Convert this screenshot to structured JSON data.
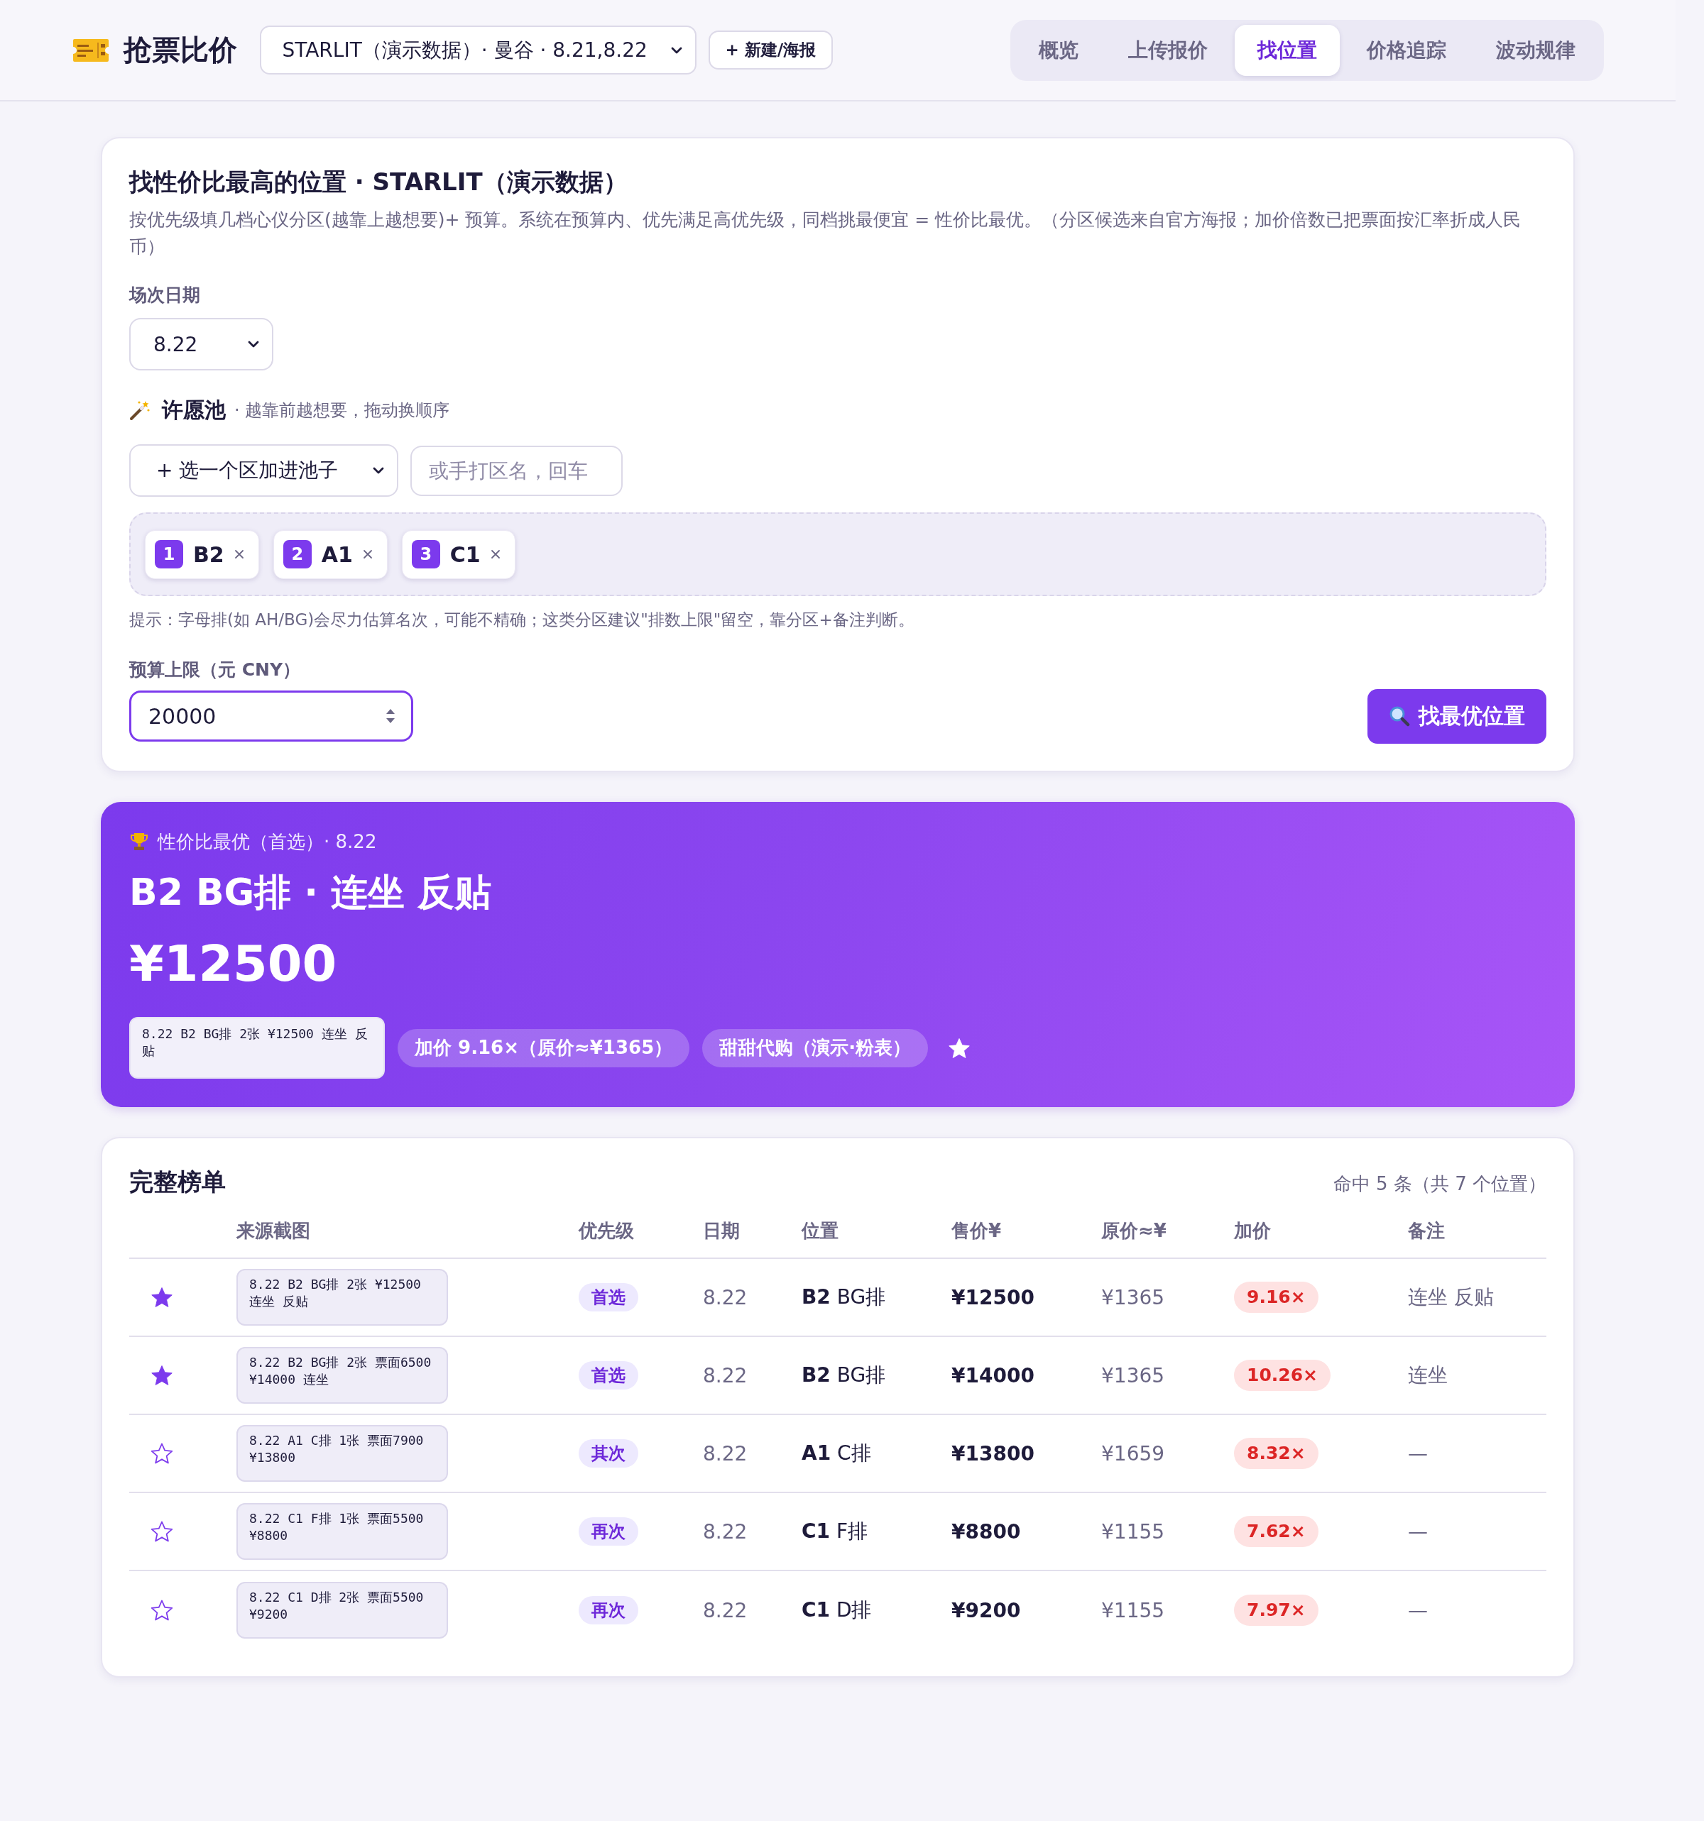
{
  "header": {
    "app_title": "抢票比价",
    "event_select": "STARLIT（演示数据）· 曼谷 · 8.21,8.22",
    "new_button": "+ 新建/海报"
  },
  "tabs": [
    {
      "label": "概览",
      "selected": false
    },
    {
      "label": "上传报价",
      "selected": false
    },
    {
      "label": "找位置",
      "selected": true
    },
    {
      "label": "价格追踪",
      "selected": false
    },
    {
      "label": "波动规律",
      "selected": false
    }
  ],
  "finder": {
    "title": "找性价比最高的位置 · STARLIT（演示数据）",
    "description": "按优先级填几档心仪分区(越靠上越想要)+ 预算。系统在预算内、优先满足高优先级，同档挑最便宜 = 性价比最优。（分区候选来自官方海报；加价倍数已把票面按汇率折成人民币）",
    "date_label": "场次日期",
    "date_select": "8.22",
    "wish_pool": {
      "title": "许愿池",
      "subtitle": "· 越靠前越想要，拖动换顺序",
      "zone_select": "+ 选一个区加进池子",
      "zone_input": {
        "placeholder": "或手打区名，回车"
      },
      "chips": [
        {
          "rank": "1",
          "zone": "B2"
        },
        {
          "rank": "2",
          "zone": "A1"
        },
        {
          "rank": "3",
          "zone": "C1"
        }
      ]
    },
    "hint": "提示：字母排(如 AH/BG)会尽力估算名次，可能不精确；这类分区建议\"排数上限\"留空，靠分区+备注判断。",
    "budget_label": "预算上限（元 CNY）",
    "budget_input": {
      "value": "20000"
    },
    "search_button": "找最优位置"
  },
  "best": {
    "caption": "性价比最优（首选）· 8.22",
    "title": "B2 BG排 · 连坐 反贴",
    "price": "¥12500",
    "snippet": "8.22 B2 BG排 2张 ¥12500 连坐 反贴",
    "markup_pill": "加价 9.16×（原价≈¥1365）",
    "seller_pill": "甜甜代购（演示·粉表）",
    "starred": true
  },
  "ranking": {
    "title": "完整榜单",
    "count": "命中 5 条（共 7 个位置）",
    "columns": [
      "来源截图",
      "优先级",
      "日期",
      "位置",
      "售价¥",
      "原价≈¥",
      "加价",
      "备注"
    ],
    "rows": [
      {
        "starred": true,
        "snippet": "8.22 B2 BG排 2张 ¥12500 连坐 反贴",
        "priority": "首选",
        "date": "8.22",
        "position": "**B2** BG排",
        "price": "¥12500",
        "original": "¥1365",
        "markup": "9.16×",
        "note": "连坐 反贴"
      },
      {
        "starred": true,
        "snippet": "8.22 B2 BG排 2张 票面6500 ¥14000 连坐",
        "priority": "首选",
        "date": "8.22",
        "position": "**B2** BG排",
        "price": "¥14000",
        "original": "¥1365",
        "markup": "10.26×",
        "note": "连坐"
      },
      {
        "starred": false,
        "snippet": "8.22 A1 C排 1张 票面7900 ¥13800",
        "priority": "其次",
        "date": "8.22",
        "position": "**A1** C排",
        "price": "¥13800",
        "original": "¥1659",
        "markup": "8.32×",
        "note": "—"
      },
      {
        "starred": false,
        "snippet": "8.22 C1 F排 1张 票面5500 ¥8800",
        "priority": "再次",
        "date": "8.22",
        "position": "**C1** F排",
        "price": "¥8800",
        "original": "¥1155",
        "markup": "7.62×",
        "note": "—"
      },
      {
        "starred": false,
        "snippet": "8.22 C1 D排 2张 票面5500 ¥9200",
        "priority": "再次",
        "date": "8.22",
        "position": "**C1** D排",
        "price": "¥9200",
        "original": "¥1155",
        "markup": "7.97×",
        "note": "—"
      }
    ]
  }
}
